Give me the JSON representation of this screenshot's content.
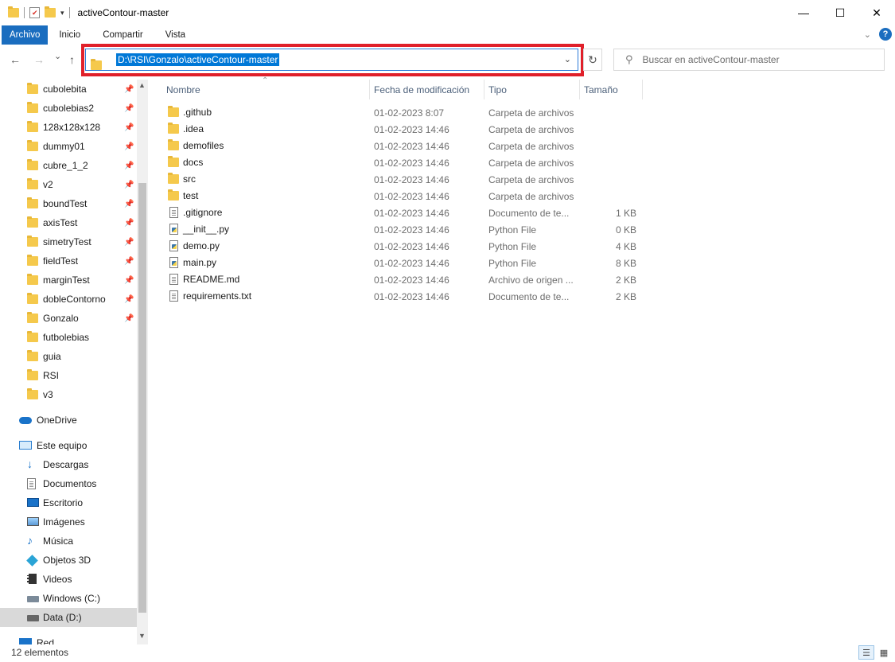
{
  "window": {
    "title": "activeContour-master",
    "minimize": "—",
    "maximize": "☐",
    "close": "✕"
  },
  "ribbon": {
    "tabs": [
      "Archivo",
      "Inicio",
      "Compartir",
      "Vista"
    ],
    "help": "?"
  },
  "nav": {
    "back": "←",
    "forward": "→",
    "recent": "⌄",
    "up": "↑",
    "address": "D:\\RSI\\Gonzalo\\activeContour-master",
    "refresh": "↻",
    "search_placeholder": "Buscar en activeContour-master"
  },
  "sidebar": {
    "quick_access": [
      {
        "label": "cubolebita",
        "pinned": true
      },
      {
        "label": "cubolebias2",
        "pinned": true
      },
      {
        "label": "128x128x128",
        "pinned": true
      },
      {
        "label": "dummy01",
        "pinned": true
      },
      {
        "label": "cubre_1_2",
        "pinned": true
      },
      {
        "label": "v2",
        "pinned": true
      },
      {
        "label": "boundTest",
        "pinned": true
      },
      {
        "label": "axisTest",
        "pinned": true
      },
      {
        "label": "simetryTest",
        "pinned": true
      },
      {
        "label": "fieldTest",
        "pinned": true
      },
      {
        "label": "marginTest",
        "pinned": true
      },
      {
        "label": "dobleContorno",
        "pinned": true
      },
      {
        "label": "Gonzalo",
        "pinned": true
      },
      {
        "label": "futbolebias",
        "pinned": false
      },
      {
        "label": "guia",
        "pinned": false
      },
      {
        "label": "RSI",
        "pinned": false
      },
      {
        "label": "v3",
        "pinned": false
      }
    ],
    "onedrive": "OneDrive",
    "this_pc": "Este equipo",
    "pc_items": [
      "Descargas",
      "Documentos",
      "Escritorio",
      "Imágenes",
      "Música",
      "Objetos 3D",
      "Videos",
      "Windows (C:)",
      "Data (D:)"
    ],
    "network": "Red",
    "pin_glyph": "📌"
  },
  "columns": {
    "name": "Nombre",
    "date": "Fecha de modificación",
    "type": "Tipo",
    "size": "Tamaño"
  },
  "files": [
    {
      "name": ".github",
      "date": "01-02-2023 8:07",
      "type": "Carpeta de archivos",
      "size": "",
      "icon": "folder-icon"
    },
    {
      "name": ".idea",
      "date": "01-02-2023 14:46",
      "type": "Carpeta de archivos",
      "size": "",
      "icon": "folder-icon"
    },
    {
      "name": "demofiles",
      "date": "01-02-2023 14:46",
      "type": "Carpeta de archivos",
      "size": "",
      "icon": "folder-icon"
    },
    {
      "name": "docs",
      "date": "01-02-2023 14:46",
      "type": "Carpeta de archivos",
      "size": "",
      "icon": "folder-icon"
    },
    {
      "name": "src",
      "date": "01-02-2023 14:46",
      "type": "Carpeta de archivos",
      "size": "",
      "icon": "folder-icon"
    },
    {
      "name": "test",
      "date": "01-02-2023 14:46",
      "type": "Carpeta de archivos",
      "size": "",
      "icon": "folder-icon"
    },
    {
      "name": ".gitignore",
      "date": "01-02-2023 14:46",
      "type": "Documento de te...",
      "size": "1 KB",
      "icon": "document-icon"
    },
    {
      "name": "__init__.py",
      "date": "01-02-2023 14:46",
      "type": "Python File",
      "size": "0 KB",
      "icon": "python-file-icon"
    },
    {
      "name": "demo.py",
      "date": "01-02-2023 14:46",
      "type": "Python File",
      "size": "4 KB",
      "icon": "python-file-icon"
    },
    {
      "name": "main.py",
      "date": "01-02-2023 14:46",
      "type": "Python File",
      "size": "8 KB",
      "icon": "python-file-icon"
    },
    {
      "name": "README.md",
      "date": "01-02-2023 14:46",
      "type": "Archivo de origen ...",
      "size": "2 KB",
      "icon": "document-icon"
    },
    {
      "name": "requirements.txt",
      "date": "01-02-2023 14:46",
      "type": "Documento de te...",
      "size": "2 KB",
      "icon": "document-icon"
    }
  ],
  "status": {
    "count": "12 elementos"
  },
  "colors": {
    "accent": "#0078d7",
    "ribbon_file": "#1a6dbf",
    "highlight_border": "#e0202a",
    "folder": "#f5c94c"
  }
}
